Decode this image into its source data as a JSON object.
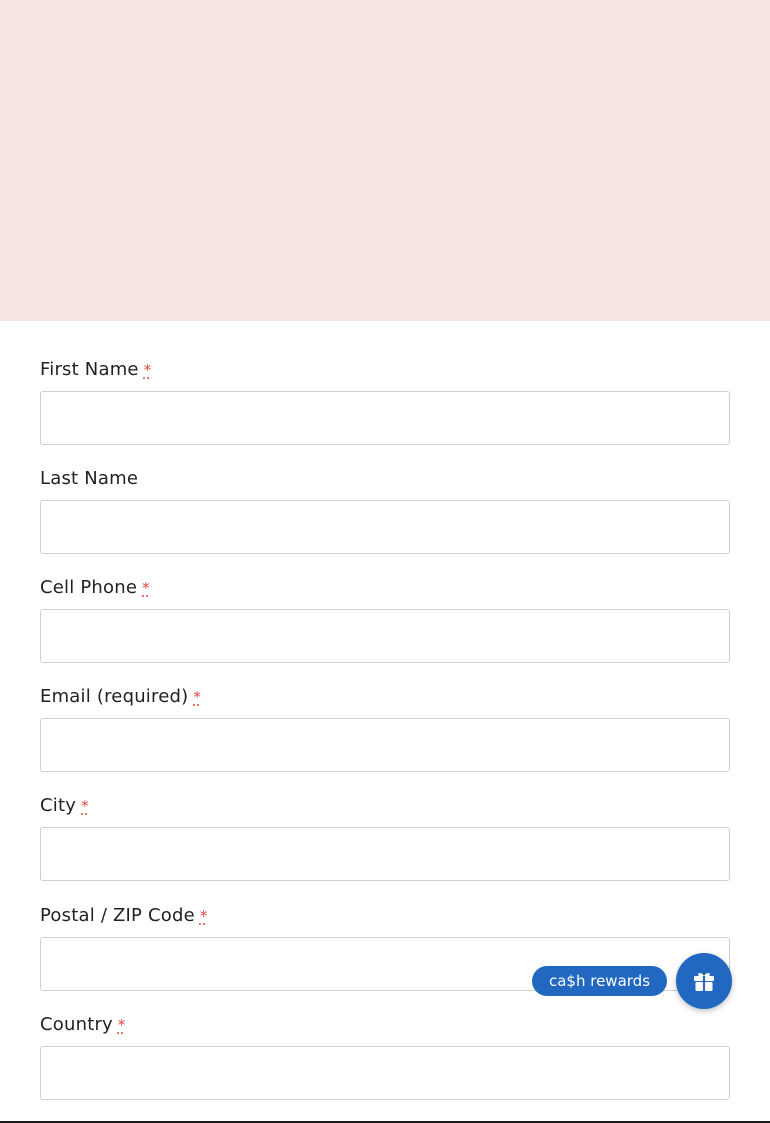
{
  "form": {
    "fields": [
      {
        "label": "First Name",
        "required_mark": "*",
        "value": ""
      },
      {
        "label": "Last Name",
        "required_mark": "",
        "value": ""
      },
      {
        "label": "Cell Phone",
        "required_mark": "*",
        "value": ""
      },
      {
        "label": "Email (required)",
        "required_mark": "*",
        "value": ""
      },
      {
        "label": "City",
        "required_mark": "*",
        "value": ""
      },
      {
        "label": "Postal / ZIP Code",
        "required_mark": "*",
        "value": ""
      },
      {
        "label": "Country",
        "required_mark": "*",
        "value": ""
      }
    ]
  },
  "rewards": {
    "label": "ca$h rewards",
    "icon": "gift-icon",
    "accent_color": "#2267c0"
  },
  "colors": {
    "hero_background": "#f8e6e5",
    "required_mark": "#e0453a"
  }
}
